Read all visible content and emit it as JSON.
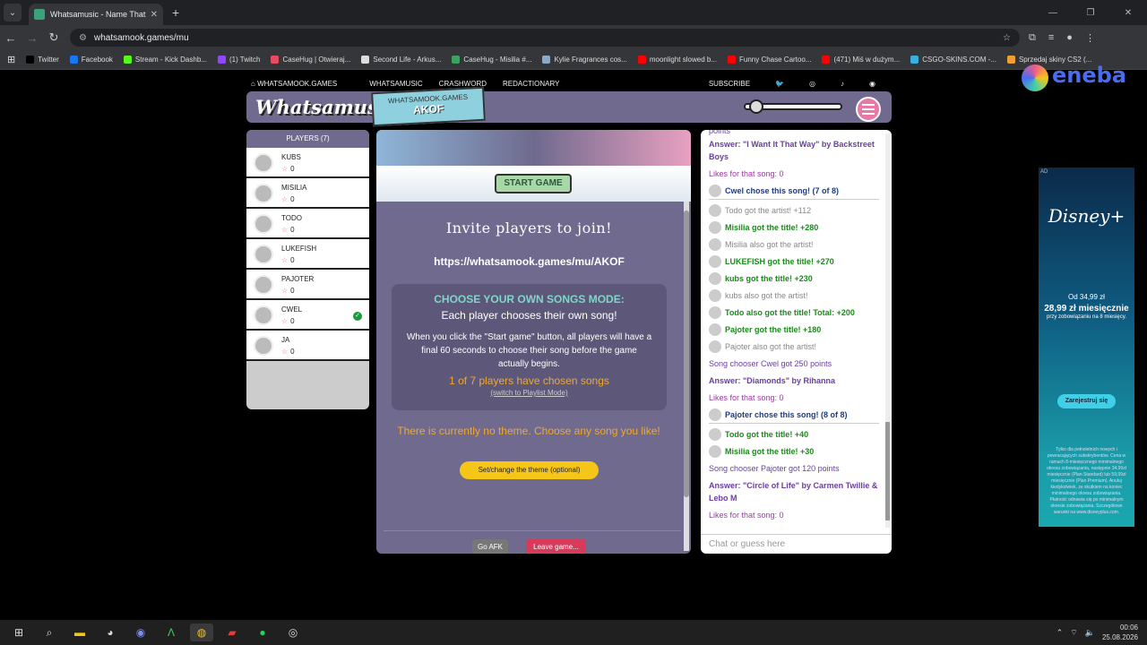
{
  "browser": {
    "tab_title": "Whatsamusic - Name That Tune",
    "url": "whatsamook.games/mu",
    "bookmarks": [
      {
        "label": "Twitter",
        "color": "#000000"
      },
      {
        "label": "Facebook",
        "color": "#1877f2"
      },
      {
        "label": "Stream - Kick Dashb...",
        "color": "#53fc18"
      },
      {
        "label": "(1) Twitch",
        "color": "#9146ff"
      },
      {
        "label": "CaseHug | Otwieraj...",
        "color": "#e84a5f"
      },
      {
        "label": "Second Life - Arkus...",
        "color": "#dddddd"
      },
      {
        "label": "CaseHug - Misilia #...",
        "color": "#3aa35c"
      },
      {
        "label": "Kylie Fragrances cos...",
        "color": "#88aacc"
      },
      {
        "label": "moonlight slowed b...",
        "color": "#ff0000"
      },
      {
        "label": "Funny Chase Cartoo...",
        "color": "#ff0000"
      },
      {
        "label": "(471) Miś w dużym...",
        "color": "#ff0000"
      },
      {
        "label": "CSGO-SKINS.COM -...",
        "color": "#3ab0e0"
      },
      {
        "label": "Sprzedaj skiny CS2 (...",
        "color": "#f0a030"
      }
    ]
  },
  "site": {
    "nav": [
      "WHATSAMOOK.GAMES",
      "WHATSAMUSIC",
      "CRASHWORD",
      "REDACTIONARY"
    ],
    "subscribe": "SUBSCRIBE",
    "logo": "Whatsamusic",
    "room_label": "WHATSAMOOK.GAMES",
    "room_code": "AKOF"
  },
  "players": {
    "header": "PLAYERS (7)",
    "list": [
      {
        "name": "KUBS",
        "score": "0",
        "chosen": false
      },
      {
        "name": "MISILIA",
        "score": "0",
        "chosen": false
      },
      {
        "name": "TODO",
        "score": "0",
        "chosen": false
      },
      {
        "name": "LUKEFISH",
        "score": "0",
        "chosen": false
      },
      {
        "name": "PAJOTER",
        "score": "0",
        "chosen": false
      },
      {
        "name": "CWEL",
        "score": "0",
        "chosen": true
      },
      {
        "name": "JA",
        "score": "0",
        "chosen": false
      }
    ]
  },
  "game": {
    "start_button": "START GAME",
    "invite_title": "Invite players to join!",
    "invite_url": "https://whatsamook.games/mu/AKOF",
    "mode_title": "CHOOSE YOUR OWN SONGS MODE:",
    "mode_subtitle": "Each player chooses their own song!",
    "mode_desc": "When you click the \"Start game\" button, all players will have a final 60 seconds to choose their song before the game actually begins.",
    "chosen_count": "1 of 7 players have chosen songs",
    "switch_link": "(switch to Playlist Mode)",
    "theme_text": "There is currently no theme. Choose any song you like!",
    "theme_button": "Set/change the theme (optional)",
    "afk_button": "Go AFK",
    "leave_button": "Leave game..."
  },
  "chat": {
    "top_cut": "points",
    "messages": [
      {
        "kind": "ans",
        "text": "Answer: \"I Want It That Way\" by Backstreet Boys"
      },
      {
        "kind": "likes",
        "text": "Likes for that song: 0"
      },
      {
        "kind": "chooser",
        "text": "Cwel chose this song! (7 of 8)"
      },
      {
        "kind": "gr",
        "text": "Todo got the artist! +112"
      },
      {
        "kind": "g",
        "text": "Misilia got the title! +280"
      },
      {
        "kind": "gr",
        "text": "Misilia also got the artist!"
      },
      {
        "kind": "g",
        "text": "LUKEFISH got the title! +270"
      },
      {
        "kind": "g",
        "text": "kubs got the title! +230"
      },
      {
        "kind": "gr",
        "text": "kubs also got the artist!"
      },
      {
        "kind": "g",
        "text": "Todo also got the title! Total: +200"
      },
      {
        "kind": "g",
        "text": "Pajoter got the title! +180"
      },
      {
        "kind": "gr",
        "text": "Pajoter also got the artist!"
      },
      {
        "kind": "pts",
        "text": "Song chooser Cwel got 250 points"
      },
      {
        "kind": "ans",
        "text": "Answer: \"Diamonds\" by Rihanna"
      },
      {
        "kind": "likes",
        "text": "Likes for that song: 0"
      },
      {
        "kind": "chooser",
        "text": "Pajoter chose this song! (8 of 8)"
      },
      {
        "kind": "g",
        "text": "Todo got the title! +40"
      },
      {
        "kind": "g",
        "text": "Misilia got the title! +30"
      },
      {
        "kind": "pts",
        "text": "Song chooser Pajoter got 120 points"
      },
      {
        "kind": "ans",
        "text": "Answer: \"Circle of Life\" by Carmen Twillie & Lebo M"
      },
      {
        "kind": "likes",
        "text": "Likes for that song: 0"
      }
    ],
    "input_placeholder": "Chat or guess here"
  },
  "ad": {
    "tag": "AD",
    "brand": "Disney+",
    "price_old": "Od 34,99 zł",
    "price_new": "28,99 zł miesięcznie",
    "price_note": "przy zobowiązaniu na 8 miesięcy.",
    "cta": "Zarejestruj się",
    "fine_print": "Tylko dla pełnoletnich nowych i powracających subskrybentów. Cena w ramach 8-miesięcznego minimalnego okresu zobowiązania, następnie 34,99zł miesięcznie (Plan Standard) lub 59,99zł miesięcznie (Plan Premium). Anuluj kiedykolwiek, ze skutkiem na koniec minimalnego okresu zobowiązania. Płatność odnawia się po minimalnym okresie zobowiązania. Szczegółowe warunki na www.disneyplus.com."
  },
  "overlay": {
    "brand": "eneba"
  },
  "taskbar": {
    "time": "00:06",
    "date": "25.08.2026"
  }
}
